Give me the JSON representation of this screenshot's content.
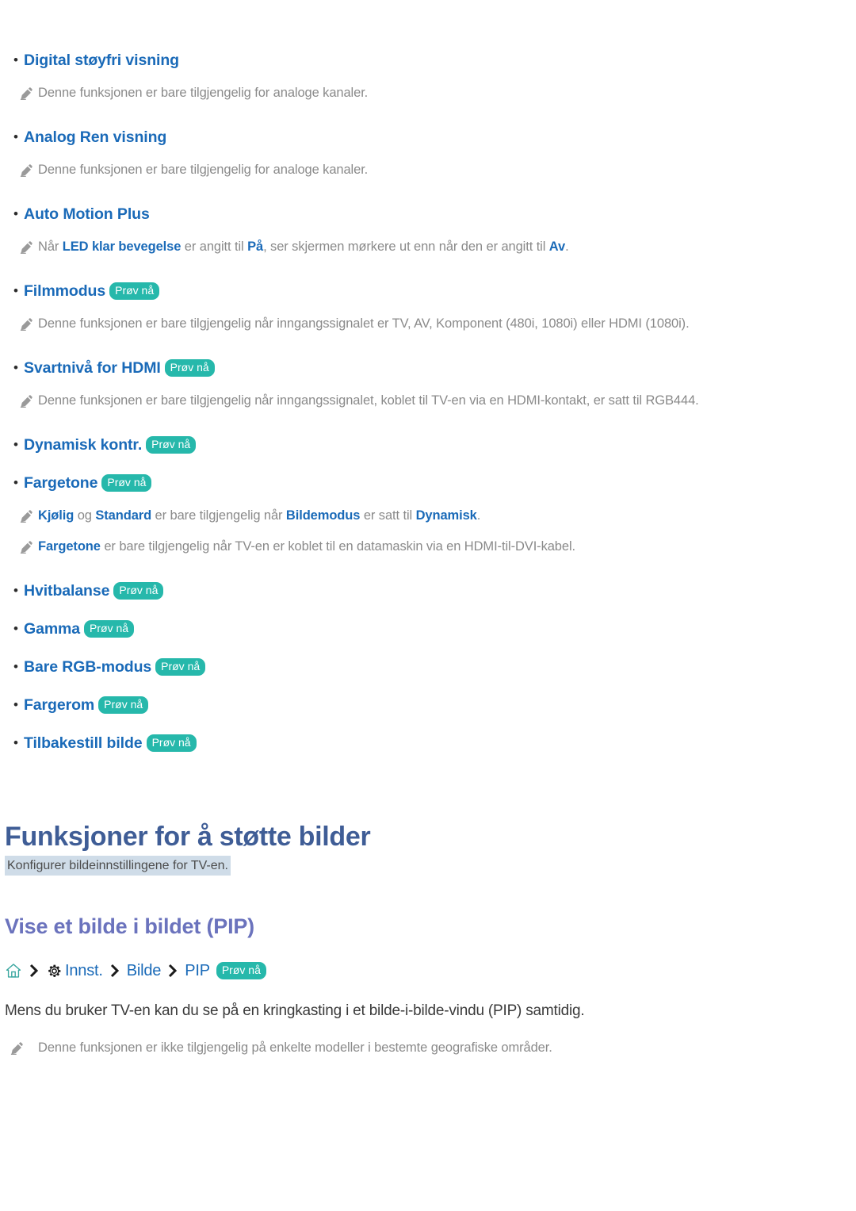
{
  "colors": {
    "link_blue": "#1a6ab8",
    "badge_teal": "#26b8ab",
    "heading_blue": "#3f5d96",
    "subheading_purple": "#6b73bd",
    "note_gray": "#8a8a8a",
    "highlight_bg": "#cfdce8"
  },
  "badge": {
    "label": "Prøv nå"
  },
  "icons": {
    "note": "pencil-icon",
    "home": "home-icon",
    "gear": "gear-icon",
    "chevron": "chevron-right-icon"
  },
  "settings_list": [
    {
      "label": "Digital støyfri visning",
      "badge": false,
      "notes": [
        {
          "parts": [
            {
              "t": "Denne funksjonen er bare tilgjengelig for analoge kanaler.",
              "b": false
            }
          ]
        }
      ]
    },
    {
      "label": "Analog Ren visning",
      "badge": false,
      "notes": [
        {
          "parts": [
            {
              "t": "Denne funksjonen er bare tilgjengelig for analoge kanaler.",
              "b": false
            }
          ]
        }
      ]
    },
    {
      "label": "Auto Motion Plus",
      "badge": false,
      "notes": [
        {
          "parts": [
            {
              "t": "Når ",
              "b": false
            },
            {
              "t": "LED klar bevegelse",
              "b": true
            },
            {
              "t": " er angitt til ",
              "b": false
            },
            {
              "t": "På",
              "b": true
            },
            {
              "t": ", ser skjermen mørkere ut enn når den er angitt til ",
              "b": false
            },
            {
              "t": "Av",
              "b": true
            },
            {
              "t": ".",
              "b": false
            }
          ]
        }
      ]
    },
    {
      "label": "Filmmodus",
      "badge": true,
      "notes": [
        {
          "parts": [
            {
              "t": "Denne funksjonen er bare tilgjengelig når inngangssignalet er TV, AV, Komponent (480i, 1080i) eller HDMI (1080i).",
              "b": false
            }
          ]
        }
      ]
    },
    {
      "label": "Svartnivå for HDMI",
      "badge": true,
      "notes": [
        {
          "parts": [
            {
              "t": "Denne funksjonen er bare tilgjengelig når inngangssignalet, koblet til TV-en via en HDMI-kontakt, er satt til RGB444.",
              "b": false
            }
          ]
        }
      ]
    },
    {
      "label": "Dynamisk kontr.",
      "badge": true,
      "notes": []
    },
    {
      "label": "Fargetone",
      "badge": true,
      "notes": [
        {
          "parts": [
            {
              "t": "Kjølig",
              "b": true
            },
            {
              "t": " og ",
              "b": false
            },
            {
              "t": "Standard",
              "b": true
            },
            {
              "t": " er bare tilgjengelig når ",
              "b": false
            },
            {
              "t": "Bildemodus",
              "b": true
            },
            {
              "t": " er satt til ",
              "b": false
            },
            {
              "t": "Dynamisk",
              "b": true
            },
            {
              "t": ".",
              "b": false
            }
          ]
        },
        {
          "parts": [
            {
              "t": "Fargetone",
              "b": true
            },
            {
              "t": " er bare tilgjengelig når TV-en er koblet til en datamaskin via en HDMI-til-DVI-kabel.",
              "b": false
            }
          ]
        }
      ]
    },
    {
      "label": "Hvitbalanse",
      "badge": true,
      "notes": []
    },
    {
      "label": "Gamma",
      "badge": true,
      "notes": []
    },
    {
      "label": "Bare RGB-modus",
      "badge": true,
      "notes": []
    },
    {
      "label": "Fargerom",
      "badge": true,
      "notes": []
    },
    {
      "label": "Tilbakestill bilde",
      "badge": true,
      "notes": []
    }
  ],
  "section": {
    "title": "Funksjoner for å støtte bilder",
    "subtitle": "Konfigurer bildeinnstillingene for TV-en.",
    "subsection_title": "Vise et bilde i bildet (PIP)",
    "breadcrumb": {
      "items": [
        {
          "type": "icon",
          "icon": "home-icon",
          "label": ""
        },
        {
          "type": "icon",
          "icon": "gear-icon",
          "label": ""
        },
        {
          "type": "text",
          "label": "Innst."
        },
        {
          "type": "text",
          "label": "Bilde"
        },
        {
          "type": "text",
          "label": "PIP"
        }
      ],
      "badge": "Prøv nå"
    },
    "paragraph": "Mens du bruker TV-en kan du se på en kringkasting i et bilde-i-bilde-vindu (PIP) samtidig.",
    "note": "Denne funksjonen er ikke tilgjengelig på enkelte modeller i bestemte geografiske områder."
  }
}
